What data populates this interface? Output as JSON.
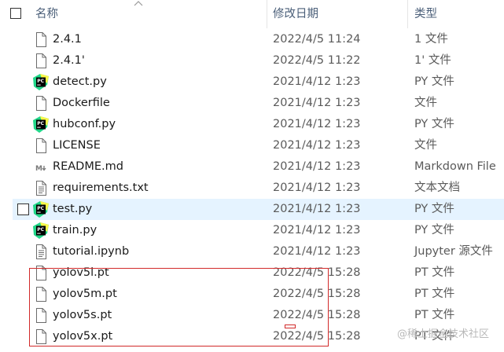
{
  "header": {
    "name": "名称",
    "date": "修改日期",
    "type": "类型"
  },
  "files": [
    {
      "name": "2.4.1",
      "date": "2022/4/5 11:24",
      "type": "1 文件",
      "icon": "file"
    },
    {
      "name": "2.4.1'",
      "date": "2022/4/5 11:22",
      "type": "1' 文件",
      "icon": "file"
    },
    {
      "name": "detect.py",
      "date": "2021/4/12 1:23",
      "type": "PY 文件",
      "icon": "pycharm"
    },
    {
      "name": "Dockerfile",
      "date": "2021/4/12 1:23",
      "type": "文件",
      "icon": "file"
    },
    {
      "name": "hubconf.py",
      "date": "2021/4/12 1:23",
      "type": "PY 文件",
      "icon": "pycharm"
    },
    {
      "name": "LICENSE",
      "date": "2021/4/12 1:23",
      "type": "文件",
      "icon": "file"
    },
    {
      "name": "README.md",
      "date": "2021/4/12 1:23",
      "type": "Markdown File",
      "icon": "markdown"
    },
    {
      "name": "requirements.txt",
      "date": "2021/4/12 1:23",
      "type": "文本文档",
      "icon": "text"
    },
    {
      "name": "test.py",
      "date": "2021/4/12 1:23",
      "type": "PY 文件",
      "icon": "pycharm",
      "selected": true
    },
    {
      "name": "train.py",
      "date": "2021/4/12 1:23",
      "type": "PY 文件",
      "icon": "pycharm"
    },
    {
      "name": "tutorial.ipynb",
      "date": "2021/4/12 1:23",
      "type": "Jupyter 源文件",
      "icon": "text"
    },
    {
      "name": "yolov5l.pt",
      "date": "2022/4/5 15:28",
      "type": "PT 文件",
      "icon": "file"
    },
    {
      "name": "yolov5m.pt",
      "date": "2022/4/5 15:28",
      "type": "PT 文件",
      "icon": "file"
    },
    {
      "name": "yolov5s.pt",
      "date": "2022/4/5 15:28",
      "type": "PT 文件",
      "icon": "file"
    },
    {
      "name": "yolov5x.pt",
      "date": "2022/4/5 15:28",
      "type": "PT 文件",
      "icon": "file"
    }
  ],
  "watermark": "@稀土掘金技术社区",
  "colors": {
    "selected_bg": "#e5f3ff",
    "highlight_box": "#d22a2a",
    "header_text": "#4c607a"
  }
}
